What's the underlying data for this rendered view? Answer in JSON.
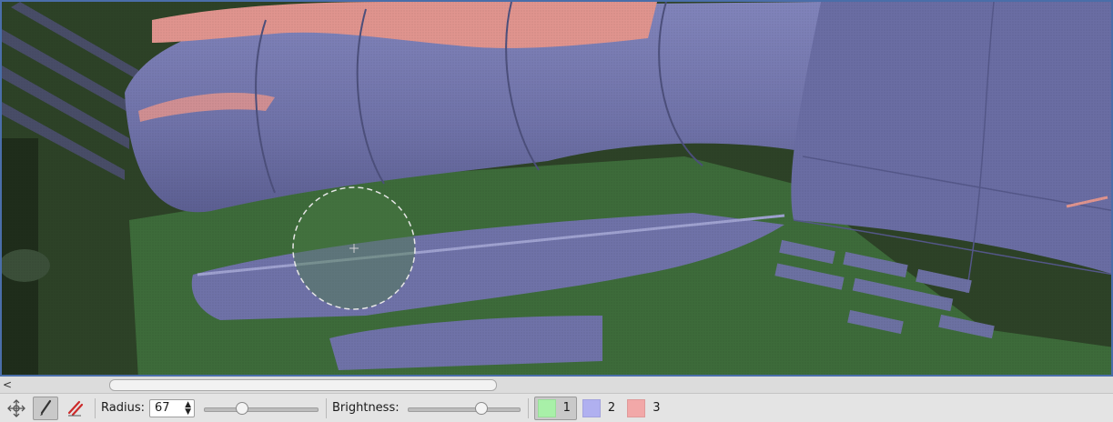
{
  "toolbar": {
    "tools": [
      {
        "icon": "move-crosshair-icon",
        "active": false
      },
      {
        "icon": "brush-icon",
        "active": true
      },
      {
        "icon": "eraser-icon",
        "active": false
      }
    ],
    "radius_label": "Radius:",
    "radius_value": "67",
    "radius_slider_fraction": 0.33,
    "brightness_label": "Brightness:",
    "brightness_slider_fraction": 0.66,
    "labels": [
      {
        "name": "1",
        "color": "#a8f0a8",
        "active": true
      },
      {
        "name": "2",
        "color": "#b0b0f0",
        "active": false
      },
      {
        "name": "3",
        "color": "#f2a8a8",
        "active": false
      }
    ]
  },
  "canvas": {
    "overlay_colors": {
      "label1": "#3d6b3a",
      "label2": "#6f72a8",
      "label3": "#e0948e"
    },
    "brush_cursor": "circle-dashed"
  },
  "scrollbar": {
    "left_arrow": "<"
  }
}
